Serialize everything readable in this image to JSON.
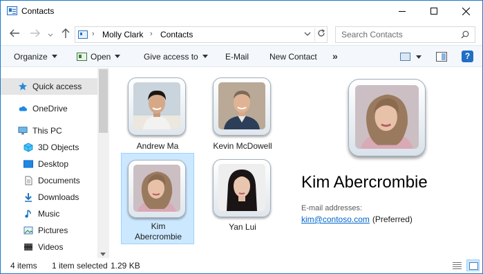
{
  "window": {
    "title": "Contacts"
  },
  "address": {
    "crumbs": [
      "Molly Clark",
      "Contacts"
    ],
    "separator": "›"
  },
  "search": {
    "placeholder": "Search Contacts"
  },
  "commands": {
    "organize": "Organize",
    "open": "Open",
    "give_access": "Give access to",
    "email": "E-Mail",
    "new_contact": "New Contact",
    "more": "»"
  },
  "nav": {
    "items": [
      {
        "label": "Quick access",
        "icon": "star-icon"
      },
      {
        "label": "OneDrive",
        "icon": "cloud-icon"
      },
      {
        "label": "This PC",
        "icon": "computer-icon"
      },
      {
        "label": "3D Objects",
        "icon": "cube-icon"
      },
      {
        "label": "Desktop",
        "icon": "desktop-icon"
      },
      {
        "label": "Documents",
        "icon": "document-icon"
      },
      {
        "label": "Downloads",
        "icon": "download-icon"
      },
      {
        "label": "Music",
        "icon": "music-icon"
      },
      {
        "label": "Pictures",
        "icon": "pictures-icon"
      },
      {
        "label": "Videos",
        "icon": "video-icon"
      }
    ]
  },
  "contacts": [
    {
      "name": "Andrew Ma"
    },
    {
      "name": "Kevin McDowell"
    },
    {
      "name_line1": "Kim",
      "name_line2": "Abercrombie",
      "selected": true
    },
    {
      "name": "Yan Lui"
    }
  ],
  "preview": {
    "name": "Kim Abercrombie",
    "email_label": "E-mail addresses:",
    "email": "kim@contoso.com",
    "email_tag": "(Preferred)"
  },
  "status": {
    "item_count": "4 items",
    "selection": "1 item selected",
    "size": "1.29 KB"
  },
  "colors": {
    "accent": "#1979ca",
    "selection": "#cce8ff",
    "link": "#0066cc"
  }
}
